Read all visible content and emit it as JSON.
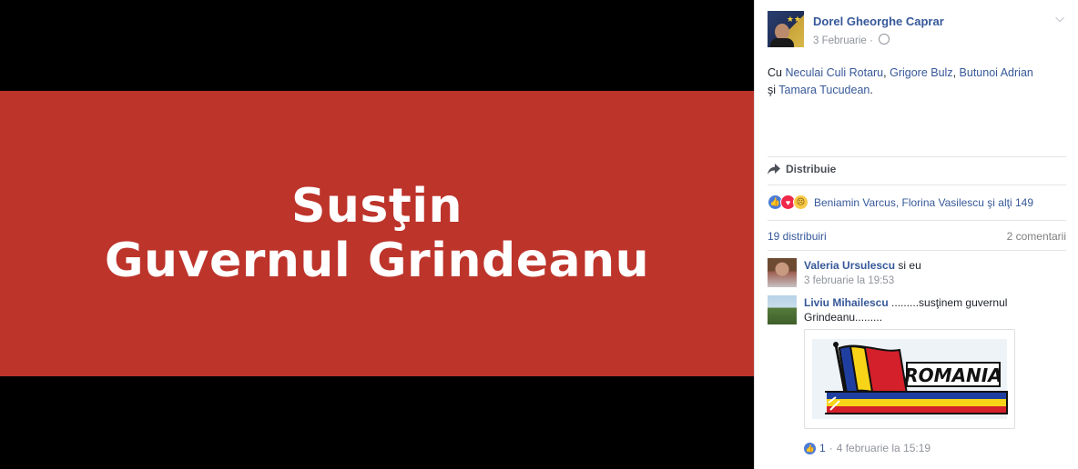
{
  "photo": {
    "banner_line1": "Susţin",
    "banner_line2": "Guvernul Grindeanu",
    "banner_color": "#bd342b",
    "background_color": "#000000"
  },
  "post": {
    "author": "Dorel Gheorghe Caprar",
    "date": "3 Februarie",
    "separator": "·",
    "privacy_icon": "globe-icon",
    "options_icon": "chevron-down-icon",
    "text_prefix": "Cu ",
    "tagged": [
      "Neculai Culi Rotaru",
      "Grigore Bulz",
      "Butunoi Adrian",
      "Tamara Tucudean"
    ],
    "text_sep1": ", ",
    "text_sep2": ", ",
    "text_sep3": " ",
    "text_and": "şi",
    "text_suffix": ".",
    "share_label": "Distribuie",
    "share_icon": "share-arrow-icon"
  },
  "reactions": {
    "icons": [
      "like-icon",
      "love-icon",
      "sad-icon"
    ],
    "names": "Beniamin Varcus, Florina Vasilescu şi alţi 149"
  },
  "stats": {
    "shares": "19 distribuiri",
    "comments": "2 comentarii"
  },
  "comments": [
    {
      "name": "Valeria Ursulescu",
      "text": " si eu",
      "time": "3 februarie la 19:53"
    },
    {
      "name": "Liviu Mihailescu",
      "text": " .........susţinem guvernul Grindeanu.........",
      "attachment_text": "ROMANIA",
      "likes": "1",
      "separator": "·",
      "time": "4 februarie la 15:19"
    }
  ],
  "colors": {
    "link": "#365899",
    "muted": "#90949c",
    "flag_blue": "#1f3fa0",
    "flag_yellow": "#f7d417",
    "flag_red": "#d3202a"
  }
}
